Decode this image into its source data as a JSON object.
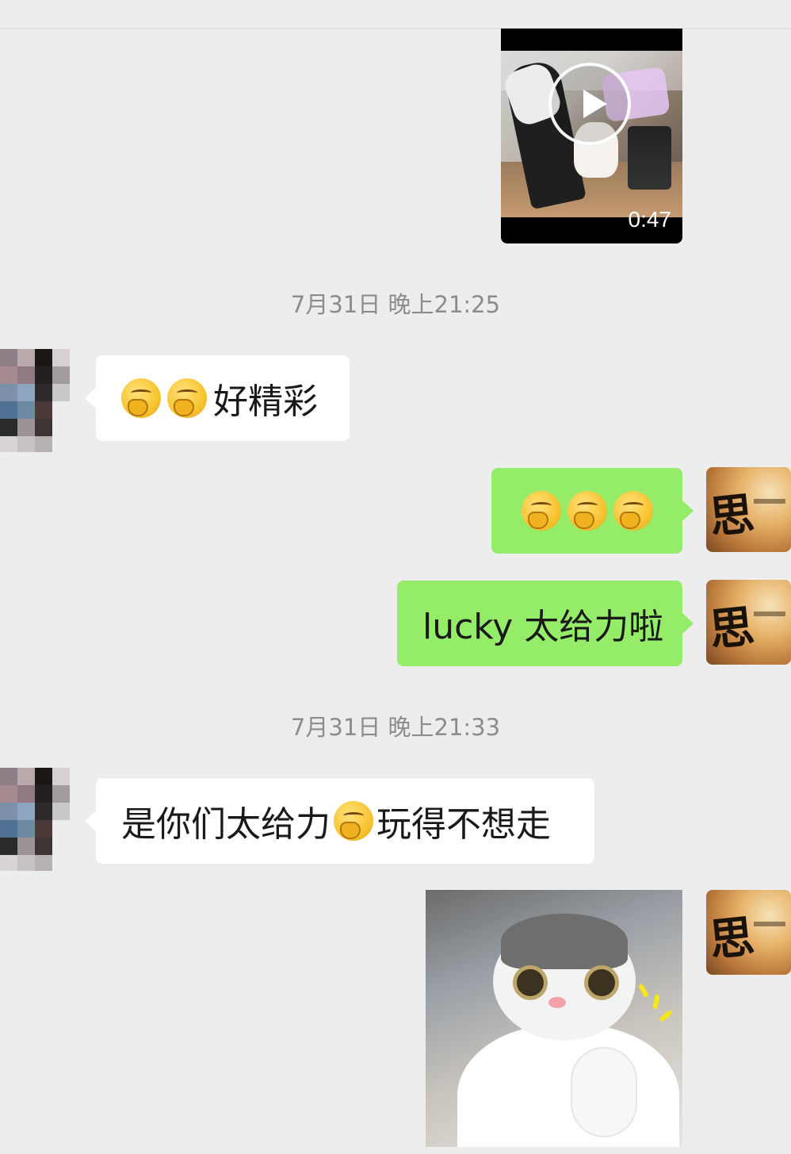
{
  "video_message": {
    "duration": "0:47"
  },
  "timestamps": [
    "7月31日 晚上21:25",
    "7月31日 晚上21:33"
  ],
  "messages": [
    {
      "side": "left",
      "text": "好精彩",
      "emoji_before": 2,
      "emoji_name": "smirk-emoji"
    },
    {
      "side": "right",
      "text": "",
      "emoji_before": 3,
      "emoji_name": "smirk-emoji"
    },
    {
      "side": "right",
      "text": "lucky 太给力啦"
    },
    {
      "side": "left",
      "text_before_emoji": "是你们太给力",
      "text_after_emoji": "玩得不想走",
      "emoji_name": "smirk-emoji"
    },
    {
      "side": "right",
      "type": "image",
      "image_desc_icon": "cat-thumbs-up-sticker"
    }
  ],
  "avatars": {
    "self_logo_text": "思迪"
  },
  "colors": {
    "background": "#ededed",
    "self_bubble": "#95ec69",
    "other_bubble": "#ffffff",
    "timestamp_text": "#8c8c8c"
  }
}
